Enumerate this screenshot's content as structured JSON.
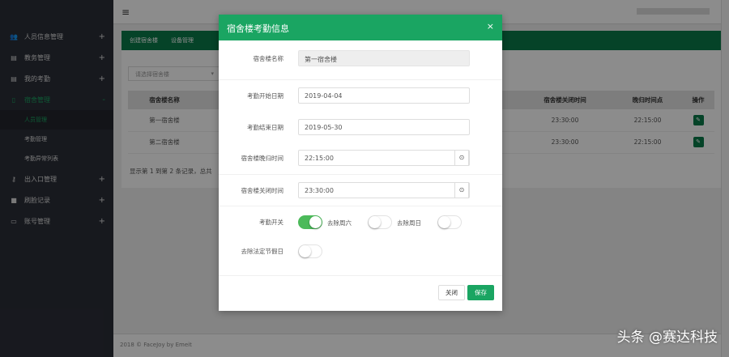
{
  "sidebar": {
    "items": [
      {
        "label": "人员信息管理",
        "icon": "users-icon",
        "glyph": "👥",
        "expand": "+"
      },
      {
        "label": "教务管理",
        "icon": "book-icon",
        "glyph": "▤",
        "expand": "+"
      },
      {
        "label": "我的考勤",
        "icon": "book-icon",
        "glyph": "▤",
        "expand": "+"
      },
      {
        "label": "宿舍管理",
        "icon": "building-icon",
        "glyph": "▯",
        "expand": "-"
      },
      {
        "label": "出入口管理",
        "icon": "key-icon",
        "glyph": "⚷",
        "expand": "+"
      },
      {
        "label": "刷脸记录",
        "icon": "video-icon",
        "glyph": "■",
        "expand": "+"
      },
      {
        "label": "账号管理",
        "icon": "card-icon",
        "glyph": "▭",
        "expand": "+"
      }
    ],
    "sub": [
      "人员管理",
      "考勤管理",
      "考勤异常列表"
    ]
  },
  "topbar": {
    "menu_glyph": "≡"
  },
  "toolbar": {
    "create": "创建宿舍楼",
    "device": "设备管理"
  },
  "filter": {
    "placeholder": "请选择宿舍楼",
    "arrow": "▾"
  },
  "table": {
    "headers": [
      "宿舍楼名称",
      "宿舍楼关闭时间",
      "晚归时间点",
      "操作"
    ],
    "rows": [
      [
        "第一宿舍楼",
        "23:30:00",
        "22:15:00"
      ],
      [
        "第二宿舍楼",
        "23:30:00",
        "22:15:00"
      ]
    ],
    "op_glyph": "✎"
  },
  "pager": "显示第 1 到第 2 条记录，总共",
  "footer": "2018 © FaceJoy by Emeit",
  "modal": {
    "title": "宿舍楼考勤信息",
    "close_glyph": "×",
    "fields": {
      "name_label": "宿舍楼名称",
      "name_value": "第一宿舍楼",
      "start_label": "考勤开始日期",
      "start_value": "2019-04-04",
      "end_label": "考勤结束日期",
      "end_value": "2019-05-30",
      "late_label": "宿舍楼晚归时间",
      "late_value": "22:15:00",
      "closing_label": "宿舍楼关闭时间",
      "closing_value": "23:30:00",
      "clock_glyph": "⊙"
    },
    "switches": {
      "attendance_label": "考勤开关",
      "attendance_on": true,
      "sat_label": "去除周六",
      "sat_on": false,
      "sun_label": "去除周日",
      "sun_on": false,
      "holiday_label": "去除法定节假日",
      "holiday_on": false
    },
    "close_btn": "关闭",
    "save_btn": "保存"
  },
  "watermark": "头条 @赛达科技"
}
